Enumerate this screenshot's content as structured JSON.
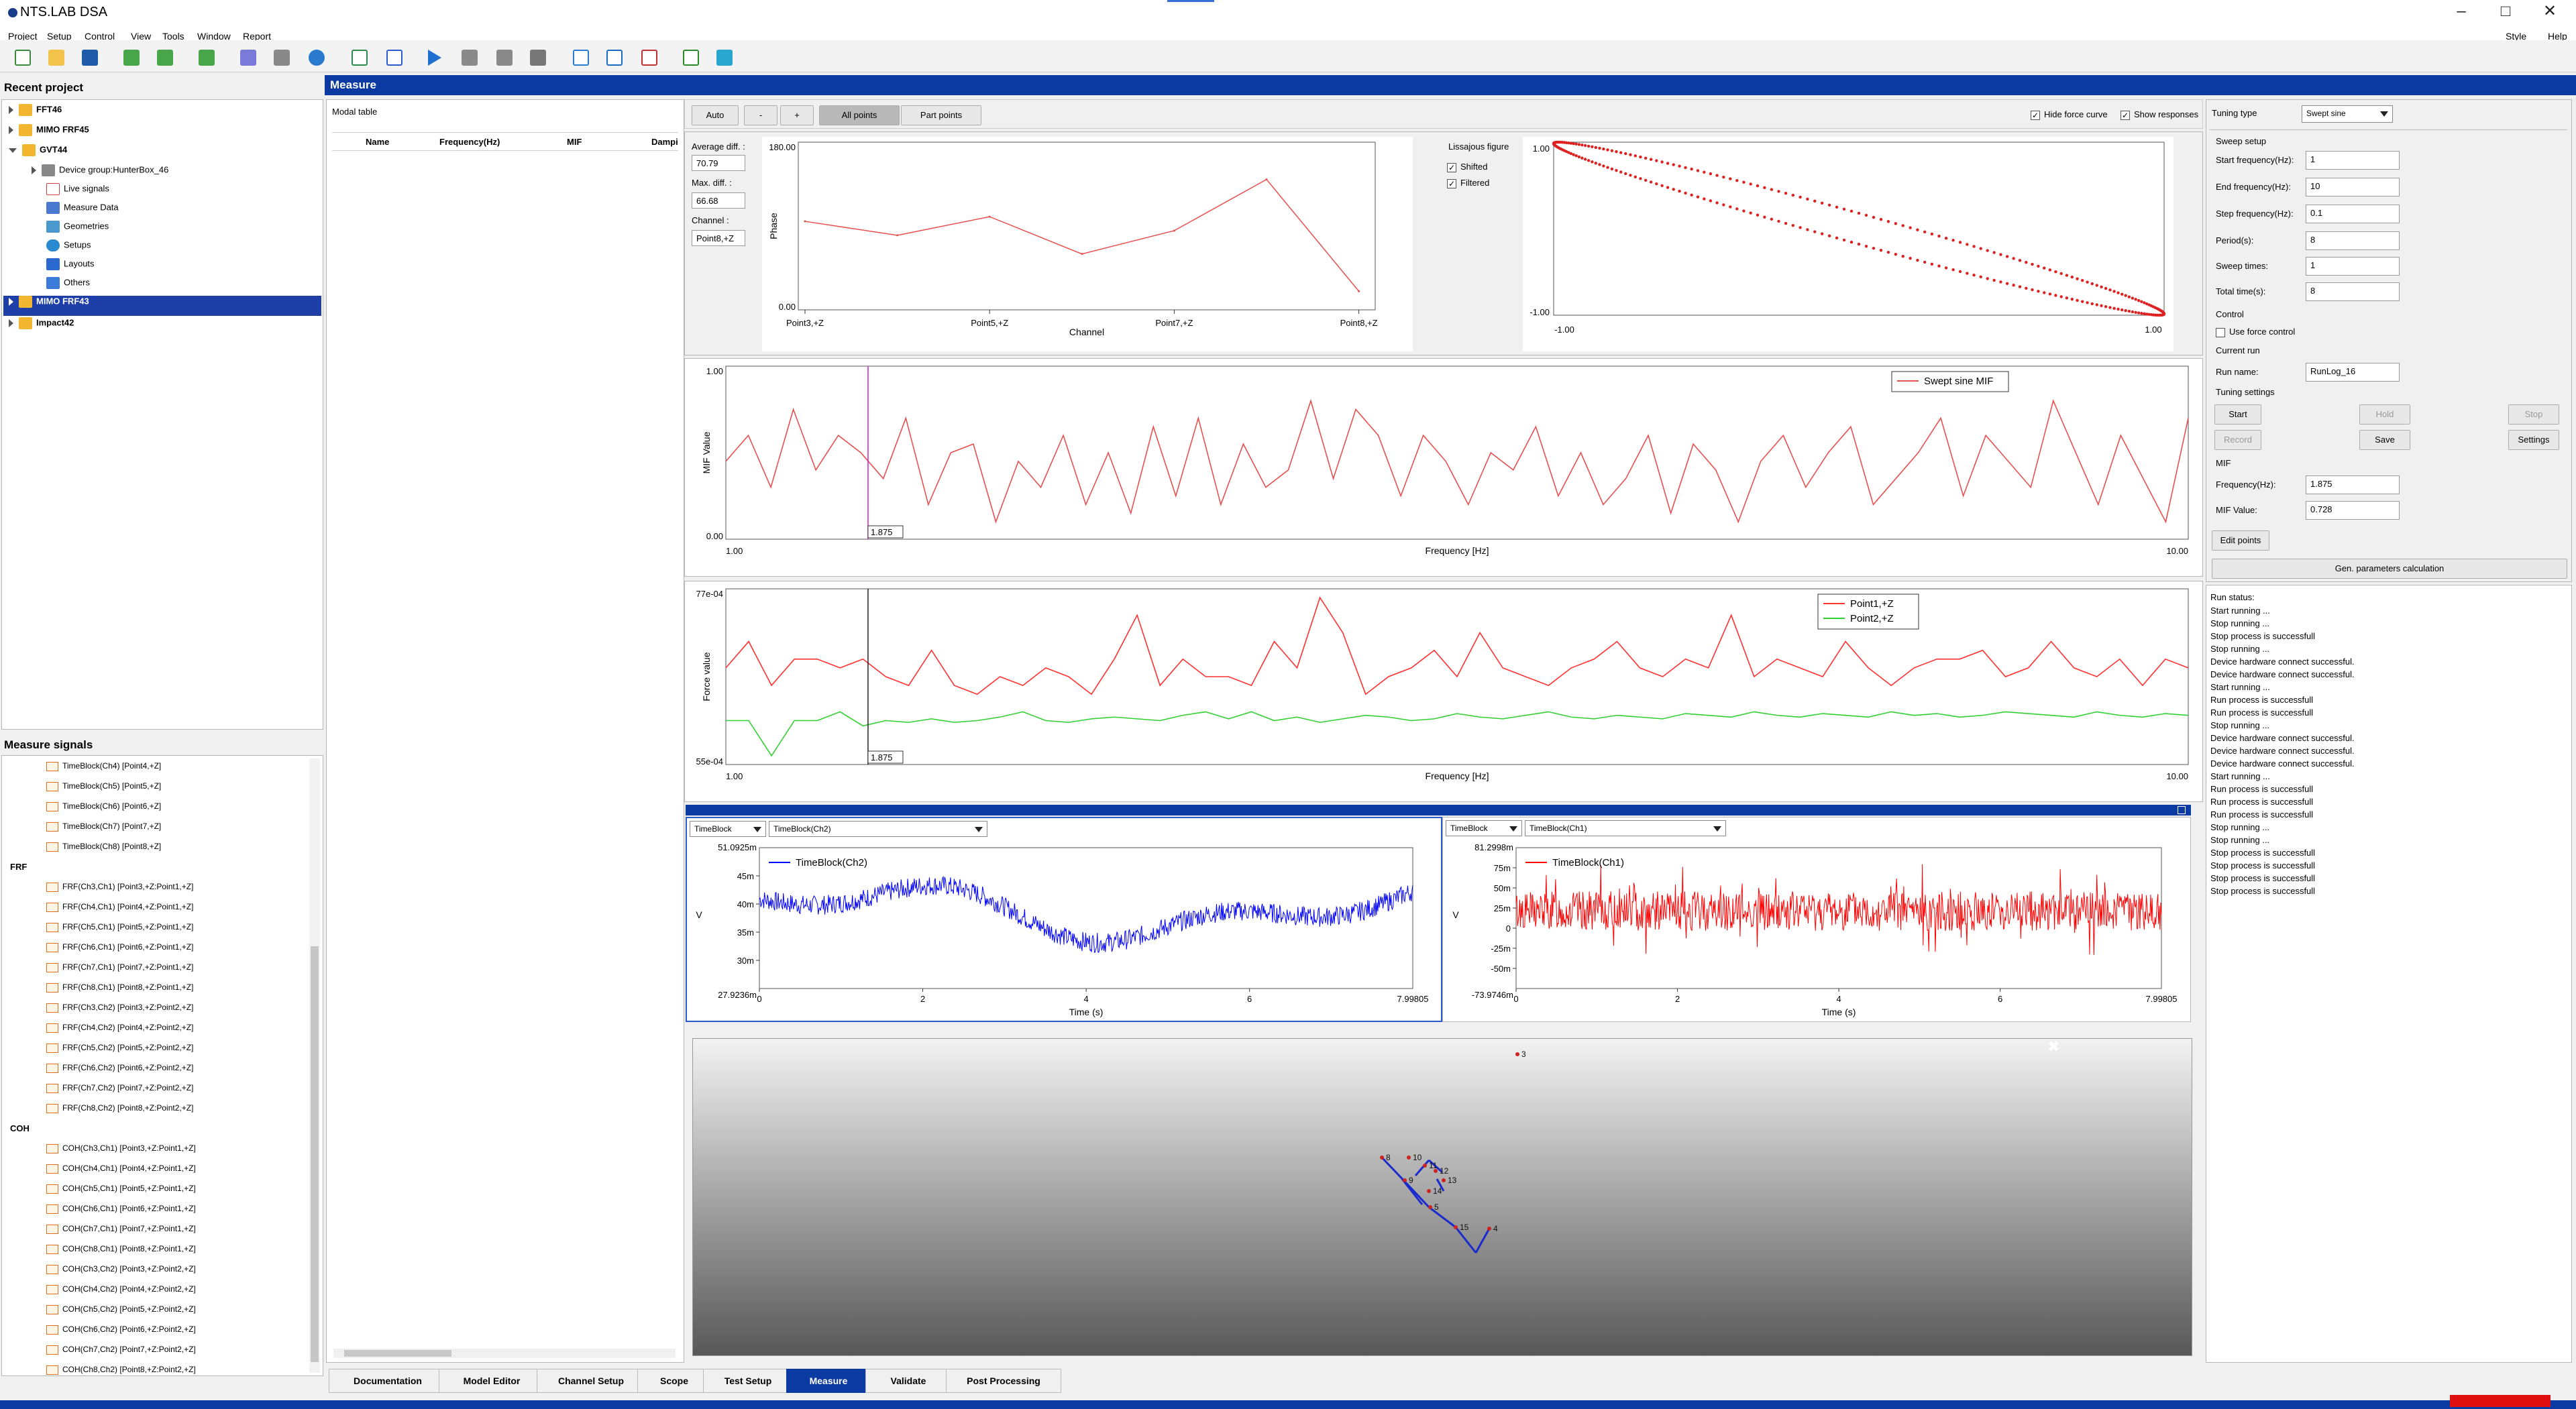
{
  "app": {
    "title": "NTS.LAB DSA",
    "style_label": "Style",
    "help_label": "Help"
  },
  "menu": [
    "Project",
    "Setup",
    "Control",
    "View",
    "Tools",
    "Window",
    "Report"
  ],
  "toolbar_icons": [
    "new-project-icon",
    "open-folder-icon",
    "save-icon",
    "import-icon",
    "export-icon",
    "load-icon",
    "cube-icon",
    "box-icon",
    "settings-icon",
    "chart-icon",
    "report-icon",
    "play-icon",
    "pause-icon",
    "stop-icon",
    "save-data-icon",
    "window-icon",
    "transfer-icon",
    "document-icon",
    "graph-icon",
    "image-icon"
  ],
  "recent_project": {
    "title": "Recent project",
    "items": [
      {
        "label": "FFT46"
      },
      {
        "label": "MIMO FRF45"
      },
      {
        "label": "GVT44",
        "children": [
          {
            "label": "Device group:HunterBox_46"
          },
          {
            "label": "Live signals"
          },
          {
            "label": "Measure Data"
          },
          {
            "label": "Geometries"
          },
          {
            "label": "Setups"
          },
          {
            "label": "Layouts"
          },
          {
            "label": "Others"
          }
        ]
      },
      {
        "label": "MIMO FRF43"
      },
      {
        "label": "Impact42"
      }
    ]
  },
  "measure_signals": {
    "title": "Measure signals",
    "timeblocks": [
      "TimeBlock(Ch4) [Point4,+Z]",
      "TimeBlock(Ch5) [Point5,+Z]",
      "TimeBlock(Ch6) [Point6,+Z]",
      "TimeBlock(Ch7) [Point7,+Z]",
      "TimeBlock(Ch8) [Point8,+Z]"
    ],
    "frf_group": "FRF",
    "frf": [
      "FRF(Ch3,Ch1) [Point3,+Z:Point1,+Z]",
      "FRF(Ch4,Ch1) [Point4,+Z:Point1,+Z]",
      "FRF(Ch5,Ch1) [Point5,+Z:Point1,+Z]",
      "FRF(Ch6,Ch1) [Point6,+Z:Point1,+Z]",
      "FRF(Ch7,Ch1) [Point7,+Z:Point1,+Z]",
      "FRF(Ch8,Ch1) [Point8,+Z:Point1,+Z]",
      "FRF(Ch3,Ch2) [Point3,+Z:Point2,+Z]",
      "FRF(Ch4,Ch2) [Point4,+Z:Point2,+Z]",
      "FRF(Ch5,Ch2) [Point5,+Z:Point2,+Z]",
      "FRF(Ch6,Ch2) [Point6,+Z:Point2,+Z]",
      "FRF(Ch7,Ch2) [Point7,+Z:Point2,+Z]",
      "FRF(Ch8,Ch2) [Point8,+Z:Point2,+Z]"
    ],
    "coh_group": "COH",
    "coh": [
      "COH(Ch3,Ch1) [Point3,+Z:Point1,+Z]",
      "COH(Ch4,Ch1) [Point4,+Z:Point1,+Z]",
      "COH(Ch5,Ch1) [Point5,+Z:Point1,+Z]",
      "COH(Ch6,Ch1) [Point6,+Z:Point1,+Z]",
      "COH(Ch7,Ch1) [Point7,+Z:Point1,+Z]",
      "COH(Ch8,Ch1) [Point8,+Z:Point1,+Z]",
      "COH(Ch3,Ch2) [Point3,+Z:Point2,+Z]",
      "COH(Ch4,Ch2) [Point4,+Z:Point2,+Z]",
      "COH(Ch5,Ch2) [Point5,+Z:Point2,+Z]",
      "COH(Ch6,Ch2) [Point6,+Z:Point2,+Z]",
      "COH(Ch7,Ch2) [Point7,+Z:Point2,+Z]",
      "COH(Ch8,Ch2) [Point8,+Z:Point2,+Z]"
    ]
  },
  "measure": {
    "title": "Measure",
    "modal_table": {
      "title": "Modal table",
      "columns": [
        "Name",
        "Frequency(Hz)",
        "MIF",
        "Dampi"
      ]
    },
    "toolbar": {
      "auto": "Auto",
      "minus": "-",
      "plus": "+",
      "all_points": "All points",
      "part_points": "Part points",
      "hide_force_curve": "Hide force curve",
      "show_responses": "Show responses"
    },
    "stats": {
      "avg_label": "Average diff. :",
      "avg_value": "70.79",
      "max_label": "Max. diff. :",
      "max_value": "66.68",
      "channel_label": "Channel :",
      "channel_value": "Point8,+Z"
    },
    "lissajous": {
      "title": "Lissajous figure",
      "shifted": "Shifted",
      "filtered": "Filtered"
    }
  },
  "tuning": {
    "type_label": "Tuning type",
    "type_value": "Swept sine",
    "sweep_setup": "Sweep setup",
    "fields": [
      {
        "label": "Start frequency(Hz):",
        "value": "1"
      },
      {
        "label": "End frequency(Hz):",
        "value": "10"
      },
      {
        "label": "Step frequency(Hz):",
        "value": "0.1"
      },
      {
        "label": "Period(s):",
        "value": "8"
      },
      {
        "label": "Sweep times:",
        "value": "1"
      },
      {
        "label": "Total time(s):",
        "value": "8"
      }
    ],
    "control": "Control",
    "use_force_control": "Use force control",
    "current_run": "Current run",
    "run_name_label": "Run name:",
    "run_name": "RunLog_16",
    "tuning_settings": "Tuning settings",
    "buttons": {
      "start": "Start",
      "hold": "Hold",
      "stop": "Stop",
      "record": "Record",
      "save": "Save",
      "settings": "Settings"
    },
    "mif": "MIF",
    "freq_label": "Frequency(Hz):",
    "freq_value": "1.875",
    "mif_label": "MIF Value:",
    "mif_value": "0.728",
    "edit_points": "Edit points",
    "gen_params": "Gen. parameters calculation"
  },
  "run_status": {
    "title": "Run status:",
    "lines": [
      "Start running ...",
      "Stop running ...",
      "Stop process is successfull",
      "Stop running ...",
      "Device hardware connect successful.",
      "Device hardware connect successful.",
      "Start running ...",
      "Run process is successfull",
      "Run process is successfull",
      "Stop running ...",
      "Device hardware connect successful.",
      "Device hardware connect successful.",
      "Device hardware connect successful.",
      "Start running ...",
      "Run process is successfull",
      "Run process is successfull",
      "Run process is successfull",
      "Stop running ...",
      "Stop running ...",
      "Stop process is successfull",
      "Stop process is successfull",
      "Stop process is successfull",
      "Stop process is successfull"
    ]
  },
  "timeblock_left": {
    "combo1": "TimeBlock",
    "combo2": "TimeBlock(Ch2)",
    "legend": "TimeBlock(Ch2)",
    "color": "#0000ff",
    "ytop": "51.0925m",
    "ybot": "27.9236m",
    "yticks": [
      "45m",
      "40m",
      "35m",
      "30m"
    ],
    "xticks": [
      "0",
      "2",
      "4",
      "6"
    ],
    "xend": "7.99805",
    "xlabel": "Time (s)",
    "ylabel": "V"
  },
  "timeblock_right": {
    "combo1": "TimeBlock",
    "combo2": "TimeBlock(Ch1)",
    "legend": "TimeBlock(Ch1)",
    "color": "#ff0000",
    "ytop": "81.2998m",
    "ybot": "-73.9746m",
    "yticks": [
      "75m",
      "50m",
      "25m",
      "0",
      "-25m",
      "-50m"
    ],
    "xticks": [
      "0",
      "2",
      "4",
      "6"
    ],
    "xend": "7.99805",
    "xlabel": "Time (s)",
    "ylabel": "V"
  },
  "workflow": [
    "Documentation",
    "Model Editor",
    "Channel Setup",
    "Scope",
    "Test Setup",
    "Measure",
    "Validate",
    "Post Processing"
  ],
  "active_step": "Measure",
  "model_labels": [
    "8",
    "10",
    "11",
    "12",
    "13",
    "14",
    "9",
    "5",
    "15",
    "4",
    "3"
  ],
  "chart_data": [
    {
      "type": "line",
      "ylabel": "Phase",
      "xlabel": "Channel",
      "categories": [
        "Point3,+Z",
        "Point5,+Z",
        "Point7,+Z",
        "Point8,+Z"
      ],
      "x": [
        0,
        0.5,
        1,
        1.5,
        2,
        2.5,
        3
      ],
      "values": [
        95,
        80,
        100,
        60,
        85,
        140,
        20
      ],
      "yticks": [
        "180.00",
        "0.00"
      ],
      "ylim": [
        0,
        180
      ],
      "color": "#e85050"
    },
    {
      "type": "scatter",
      "title": "Lissajous figure",
      "xticks": [
        "-1.00",
        "1.00"
      ],
      "yticks": [
        "1.00",
        "-1.00"
      ],
      "xlim": [
        -1,
        1
      ],
      "ylim": [
        -1,
        1
      ],
      "color": "#dd2020"
    },
    {
      "type": "line",
      "ylabel": "MIF Value",
      "xlabel": "Frequency [Hz]",
      "legend": [
        "Swept sine MIF"
      ],
      "marker": "1.875",
      "xticks": [
        "1.00",
        "10.00"
      ],
      "yticks": [
        "1.00",
        "0.00"
      ],
      "xlim": [
        1,
        10
      ],
      "ylim": [
        0,
        1
      ],
      "marker_x": 1.875,
      "series": [
        {
          "name": "Swept sine MIF",
          "color": "#e85050",
          "values": [
            0.45,
            0.6,
            0.3,
            0.75,
            0.4,
            0.6,
            0.5,
            0.35,
            0.7,
            0.2,
            0.5,
            0.55,
            0.1,
            0.45,
            0.3,
            0.6,
            0.2,
            0.5,
            0.15,
            0.65,
            0.25,
            0.7,
            0.2,
            0.55,
            0.3,
            0.4,
            0.8,
            0.35,
            0.75,
            0.6,
            0.25,
            0.6,
            0.45,
            0.2,
            0.5,
            0.4,
            0.65,
            0.25,
            0.5,
            0.2,
            0.35,
            0.6,
            0.15,
            0.55,
            0.4,
            0.1,
            0.45,
            0.6,
            0.3,
            0.5,
            0.65,
            0.2,
            0.35,
            0.5,
            0.7,
            0.25,
            0.6,
            0.45,
            0.3,
            0.8,
            0.5,
            0.2,
            0.6,
            0.35,
            0.1,
            0.7
          ]
        }
      ]
    },
    {
      "type": "line",
      "ylabel": "Force value",
      "xlabel": "Frequency [Hz]",
      "legend": [
        "Point1,+Z",
        "Point2,+Z"
      ],
      "marker": "1.875",
      "xticks": [
        "1.00",
        "10.00"
      ],
      "yticks": [
        "77e-04",
        "55e-04"
      ],
      "xlim": [
        1,
        10
      ],
      "marker_x": 1.875,
      "series": [
        {
          "name": "Point1,+Z",
          "color": "#ff3030",
          "values": [
            0.55,
            0.7,
            0.45,
            0.6,
            0.6,
            0.55,
            0.6,
            0.5,
            0.45,
            0.65,
            0.45,
            0.4,
            0.5,
            0.45,
            0.55,
            0.5,
            0.4,
            0.6,
            0.85,
            0.45,
            0.6,
            0.5,
            0.5,
            0.45,
            0.7,
            0.55,
            0.95,
            0.75,
            0.4,
            0.5,
            0.55,
            0.65,
            0.5,
            0.75,
            0.55,
            0.5,
            0.45,
            0.55,
            0.6,
            0.7,
            0.55,
            0.5,
            0.6,
            0.55,
            0.85,
            0.5,
            0.6,
            0.55,
            0.5,
            0.7,
            0.55,
            0.45,
            0.55,
            0.6,
            0.6,
            0.65,
            0.5,
            0.55,
            0.7,
            0.55,
            0.5,
            0.6,
            0.45,
            0.6,
            0.55
          ]
        },
        {
          "name": "Point2,+Z",
          "color": "#30d030",
          "values": [
            0.25,
            0.25,
            0.05,
            0.25,
            0.25,
            0.3,
            0.22,
            0.25,
            0.24,
            0.26,
            0.24,
            0.25,
            0.27,
            0.3,
            0.25,
            0.24,
            0.26,
            0.27,
            0.26,
            0.25,
            0.28,
            0.3,
            0.26,
            0.3,
            0.25,
            0.27,
            0.24,
            0.26,
            0.28,
            0.27,
            0.25,
            0.26,
            0.29,
            0.27,
            0.26,
            0.28,
            0.3,
            0.27,
            0.26,
            0.28,
            0.27,
            0.26,
            0.29,
            0.28,
            0.27,
            0.3,
            0.28,
            0.27,
            0.29,
            0.28,
            0.27,
            0.3,
            0.28,
            0.29,
            0.27,
            0.28,
            0.3,
            0.29,
            0.28,
            0.27,
            0.3,
            0.28,
            0.27,
            0.29,
            0.28
          ]
        }
      ]
    }
  ]
}
